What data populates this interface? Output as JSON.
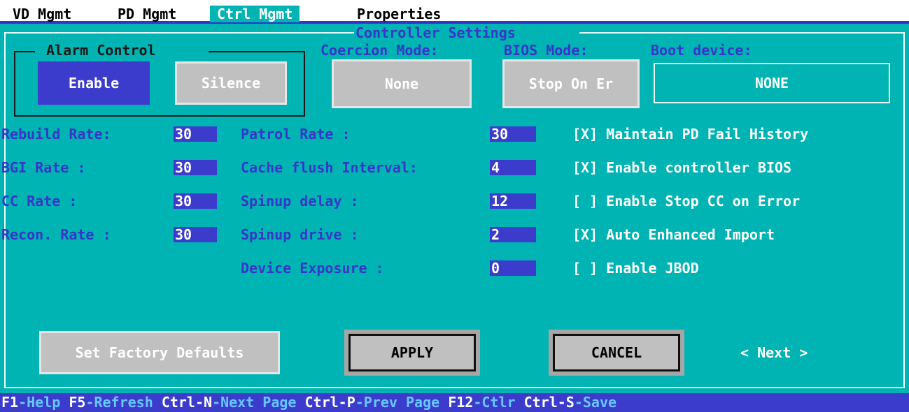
{
  "tabs": [
    {
      "label": "VD Mgmt"
    },
    {
      "label": "PD Mgmt"
    },
    {
      "label": "Ctrl Mgmt"
    },
    {
      "label": "Properties"
    }
  ],
  "section_title": "Controller Settings",
  "alarm": {
    "title": "Alarm Control",
    "enable_label": "Enable",
    "silence_label": "Silence"
  },
  "coercion": {
    "label": "Coercion Mode:",
    "value": "None"
  },
  "bios_mode": {
    "label": "BIOS Mode:",
    "value": "Stop On Er"
  },
  "boot_device": {
    "label": "Boot device:",
    "value": "NONE"
  },
  "rates_left": [
    {
      "label": "Rebuild Rate:",
      "value": "30"
    },
    {
      "label": "BGI  Rate    :",
      "value": "30"
    },
    {
      "label": "CC   Rate    :",
      "value": "30"
    },
    {
      "label": "Recon. Rate :",
      "value": "30"
    }
  ],
  "rates_mid": [
    {
      "label": "Patrol Rate           :",
      "value": "30"
    },
    {
      "label": "Cache flush Interval:",
      "value": "4"
    },
    {
      "label": "Spinup delay          :",
      "value": "12"
    },
    {
      "label": "Spinup drive          :",
      "value": "2"
    },
    {
      "label": "Device Exposure       :",
      "value": "0"
    }
  ],
  "checkboxes": [
    {
      "mark": "[X]",
      "label": "Maintain PD Fail History"
    },
    {
      "mark": "[X]",
      "label": "Enable controller BIOS"
    },
    {
      "mark": "[ ]",
      "label": "Enable Stop CC on Error"
    },
    {
      "mark": "[X]",
      "label": "Auto Enhanced Import"
    },
    {
      "mark": "[ ]",
      "label": "Enable JBOD"
    }
  ],
  "buttons": {
    "factory": "Set Factory Defaults",
    "apply": "APPLY",
    "cancel": "CANCEL",
    "next": "< Next >"
  },
  "status": [
    {
      "key": "F1",
      "desc": "-Help "
    },
    {
      "key": "F5",
      "desc": "-Refresh "
    },
    {
      "key": "Ctrl-N",
      "desc": "-Next Page "
    },
    {
      "key": "Ctrl-P",
      "desc": "-Prev Page "
    },
    {
      "key": "F12",
      "desc": "-Ctlr "
    },
    {
      "key": "Ctrl-S",
      "desc": "-Save"
    }
  ],
  "colors": {
    "background": "#00b4b4",
    "highlight": "#3c3ccc",
    "label": "#3636c8",
    "button": "#c0c0c0"
  }
}
